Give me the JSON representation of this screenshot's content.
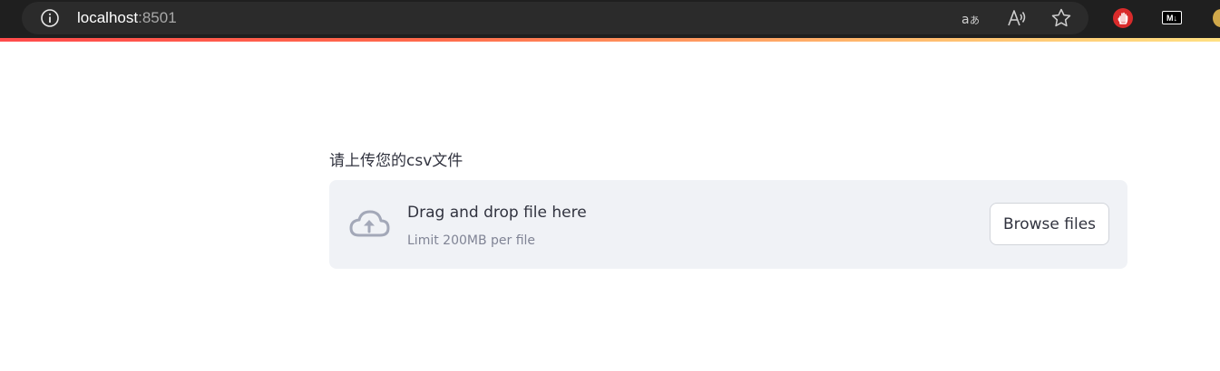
{
  "browser": {
    "url_host": "localhost",
    "url_port": ":8501",
    "icons": {
      "info": "info-icon",
      "translate": "translate-icon",
      "read_aloud": "read-aloud-icon",
      "favorite": "star-icon",
      "extension_1": "stop-hand-icon",
      "extension_2": "markdown-icon",
      "extension_3": "extension-icon"
    },
    "extension_md_label": "M↓"
  },
  "uploader": {
    "label": "请上传您的csv文件",
    "drop_title": "Drag and drop file here",
    "drop_limit": "Limit 200MB per file",
    "browse_label": "Browse files",
    "icon": "cloud-upload-icon"
  },
  "colors": {
    "accent": "#ff4b4b",
    "dropzone_bg": "#f0f2f6",
    "text": "#31333f",
    "muted_text": "#808495"
  }
}
